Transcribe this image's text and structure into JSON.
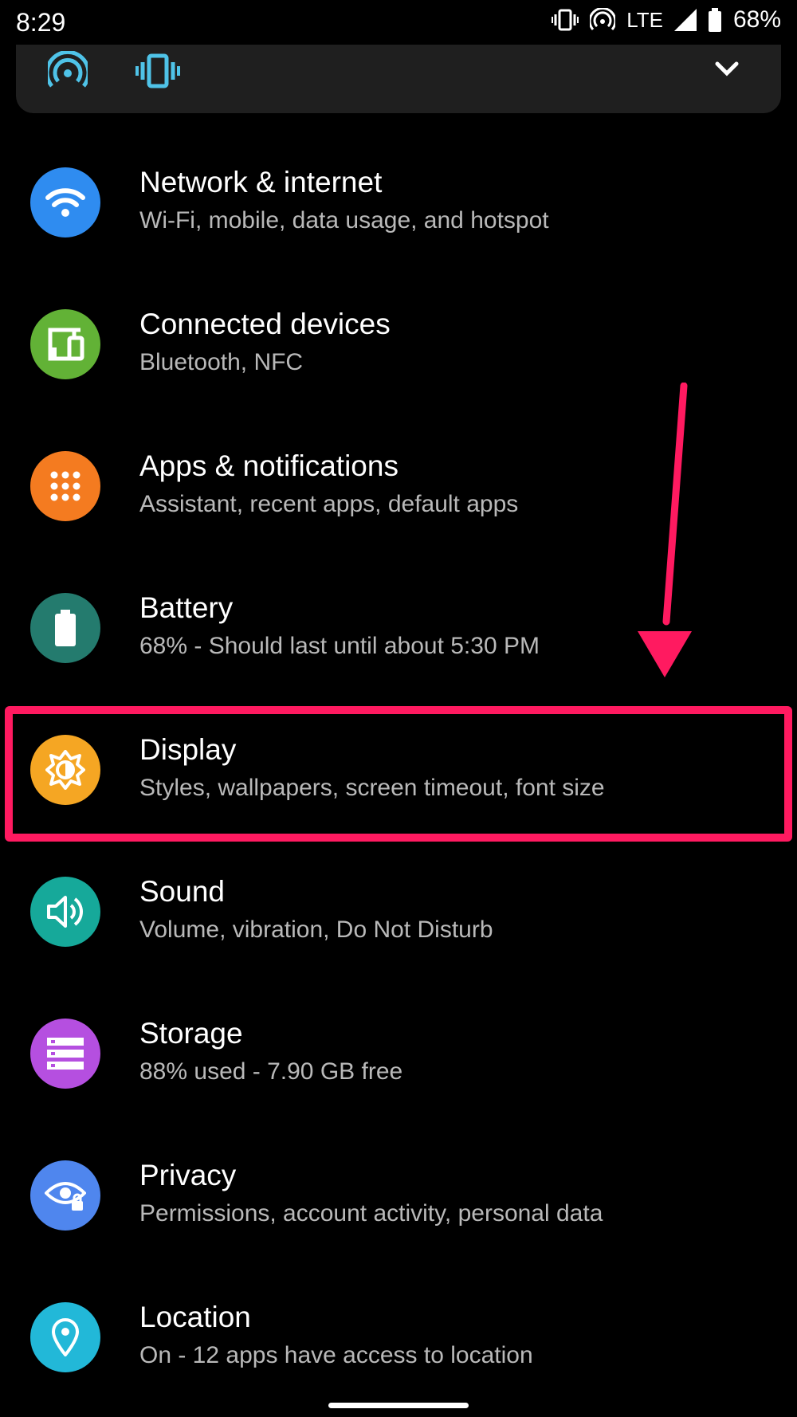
{
  "status_bar": {
    "time": "8:29",
    "network": "LTE",
    "battery": "68%",
    "icons": [
      "vibrate-icon",
      "hotspot-icon",
      "signal-icon",
      "battery-icon"
    ]
  },
  "quick_settings": {
    "icons": [
      "hotspot-icon",
      "vibrate-icon",
      "chevron-down-icon"
    ],
    "accent": "#4fc3e8"
  },
  "settings": [
    {
      "id": "network",
      "title": "Network & internet",
      "subtitle": "Wi-Fi, mobile, data usage, and hotspot",
      "icon": "wifi-icon",
      "color": "#2f8cf0"
    },
    {
      "id": "connected-devices",
      "title": "Connected devices",
      "subtitle": "Bluetooth, NFC",
      "icon": "devices-icon",
      "color": "#62b236"
    },
    {
      "id": "apps",
      "title": "Apps & notifications",
      "subtitle": "Assistant, recent apps, default apps",
      "icon": "apps-grid-icon",
      "color": "#f47b20"
    },
    {
      "id": "battery",
      "title": "Battery",
      "subtitle": "68% - Should last until about 5:30 PM",
      "icon": "battery-icon",
      "color": "#247b6e"
    },
    {
      "id": "display",
      "title": "Display",
      "subtitle": "Styles, wallpapers, screen timeout, font size",
      "icon": "brightness-icon",
      "color": "#f5a623"
    },
    {
      "id": "sound",
      "title": "Sound",
      "subtitle": "Volume, vibration, Do Not Disturb",
      "icon": "volume-icon",
      "color": "#16a99a"
    },
    {
      "id": "storage",
      "title": "Storage",
      "subtitle": "88% used - 7.90 GB free",
      "icon": "storage-icon",
      "color": "#b54fe0"
    },
    {
      "id": "privacy",
      "title": "Privacy",
      "subtitle": "Permissions, account activity, personal data",
      "icon": "privacy-eye-icon",
      "color": "#4f86ee"
    },
    {
      "id": "location",
      "title": "Location",
      "subtitle": "On - 12 apps have access to location",
      "icon": "location-pin-icon",
      "color": "#22b8d8"
    }
  ],
  "annotation": {
    "highlight_color": "#ff1a60",
    "highlighted_item": "display"
  }
}
